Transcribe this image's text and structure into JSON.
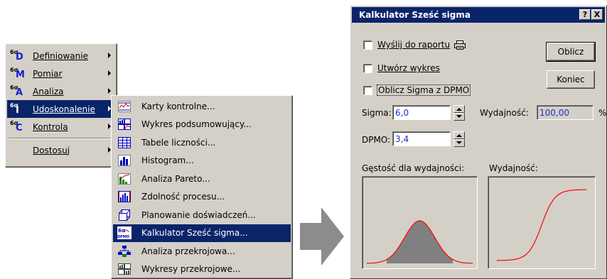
{
  "menu": {
    "items": [
      {
        "sup": "6σ",
        "letter": "D",
        "label": "Definiowanie",
        "highlighted": false
      },
      {
        "sup": "6σ",
        "letter": "M",
        "label": "Pomiar",
        "highlighted": false
      },
      {
        "sup": "6σ",
        "letter": "A",
        "label": "Analiza",
        "highlighted": false
      },
      {
        "sup": "6σ",
        "letter": "I",
        "label": "Udoskonalenie",
        "highlighted": true
      },
      {
        "sup": "6σ",
        "letter": "C",
        "label": "Kontrola",
        "highlighted": false
      }
    ],
    "customize_label": "Dostosuj"
  },
  "submenu": {
    "items": [
      {
        "label": "Karty kontrolne...",
        "icon": "control-chart-icon"
      },
      {
        "label": "Wykres podsumowujący...",
        "icon": "summary-chart-icon"
      },
      {
        "label": "Tabele liczności...",
        "icon": "table-icon"
      },
      {
        "label": "Histogram...",
        "icon": "histogram-icon"
      },
      {
        "label": "Analiza Pareto...",
        "icon": "pareto-icon"
      },
      {
        "label": "Zdolność procesu...",
        "icon": "capability-icon"
      },
      {
        "label": "Planowanie doświadczeń...",
        "icon": "doe-icon"
      },
      {
        "label": "Kalkulator Sześć sigma...",
        "icon": "sigma-calculator-icon",
        "highlighted": true
      },
      {
        "label": "Analiza przekrojowa...",
        "icon": "drilldown-icon"
      },
      {
        "label": "Wykresy przekrojowe...",
        "icon": "drilldown-charts-icon"
      }
    ]
  },
  "dialog": {
    "title": "Kalkulator Sześć sigma",
    "help_button": "?",
    "close_button": "X",
    "send_to_report": "Wyślij do raportu",
    "create_chart": "Utwórz wykres",
    "calc_from_dpmo": "Oblicz Sigma z DPMO",
    "calculate_button": "Oblicz",
    "end_button": "Koniec",
    "sigma_label": "Sigma:",
    "sigma_value": "6,0",
    "yield_label": "Wydajność:",
    "yield_value": "100,00",
    "percent": "%",
    "dpmo_label": "DPMO:",
    "dpmo_value": "3,4",
    "density_title": "Gęstość dla wydajności:",
    "yield_plot_title": "Wydajność:"
  },
  "colors": {
    "highlight": "#0a246a",
    "face": "#d4d0c8",
    "curve": "#ff0000",
    "fill": "#808080",
    "value_text": "#1a30c8"
  }
}
